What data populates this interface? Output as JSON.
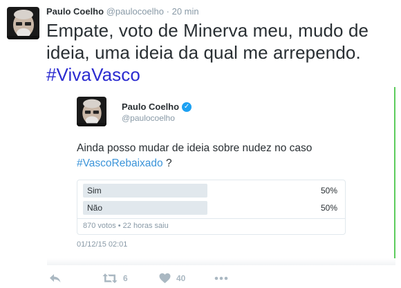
{
  "tweet": {
    "author_name": "Paulo Coelho",
    "author_handle": "@paulocoelho",
    "separator": "·",
    "time": "20 min",
    "text": "Empate, voto de Minerva meu, mudo de ideia, uma ideia da qual me arrependo.",
    "hashtag": "#VivaVasco"
  },
  "embedded": {
    "author_name": "Paulo Coelho",
    "author_handle": "@paulocoelho",
    "verified_icon": "verified-badge-icon",
    "text": "Ainda posso mudar de ideia sobre nudez no caso",
    "hashtag": "#VascoRebaixado",
    "text_end": " ?",
    "poll": {
      "options": [
        {
          "label": "Sim",
          "percent_text": "50%",
          "fraction": 0.5
        },
        {
          "label": "Não",
          "percent_text": "50%",
          "fraction": 0.5
        }
      ],
      "meta": "870 votos • 22 horas saiu"
    },
    "date": "01/12/15 02:01"
  },
  "actions": {
    "reply_icon": "reply-icon",
    "retweet_icon": "retweet-icon",
    "retweet_count": "6",
    "like_icon": "heart-icon",
    "like_count": "40",
    "more_icon": "more-icon"
  },
  "colors": {
    "hashtag_main": "#2b2bd0",
    "hashtag_embedded": "#3b94d9",
    "muted": "#8899a6",
    "poll_bar": "#e1e8ed",
    "card_border": "#5ccc5c"
  }
}
